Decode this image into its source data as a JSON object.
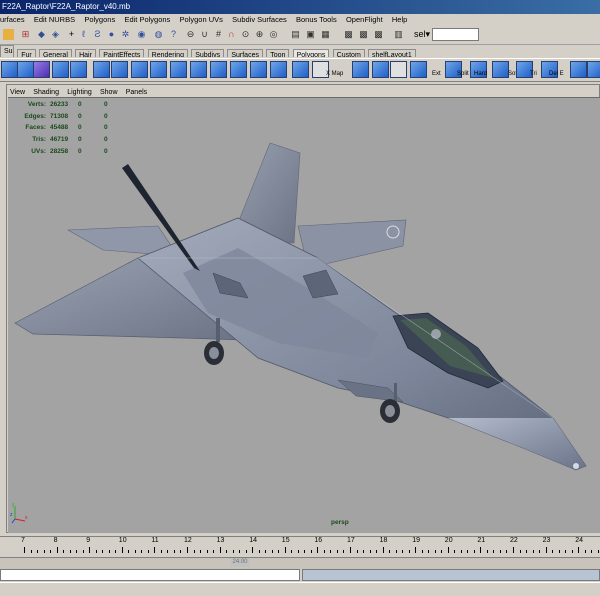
{
  "window": {
    "title": "F22A_Raptor\\F22A_Raptor_v40.mb"
  },
  "menu": [
    "urfaces",
    "Edit NURBS",
    "Polygons",
    "Edit Polygons",
    "Polygon UVs",
    "Subdiv Surfaces",
    "Bonus Tools",
    "OpenFlight",
    "Help"
  ],
  "status_line": {
    "selection_field_label": "sel▾",
    "selection_field_value": ""
  },
  "shelf_tabs": [
    "Subdivs",
    "Fur",
    "General",
    "Hair",
    "PaintEffects",
    "Rendering",
    "Subdivs",
    "Surfaces",
    "Toon",
    "Polygons",
    "Custom",
    "shelfLayout1"
  ],
  "active_shelf_tab": "Polygons",
  "shelf_labels": [
    "X Map",
    "Ext",
    "Split",
    "Hard",
    "Soft",
    "Tri",
    "Del E"
  ],
  "panel_menu": [
    "View",
    "Shading",
    "Lighting",
    "Show",
    "Panels"
  ],
  "hud": [
    {
      "label": "Verts:",
      "v1": "26233",
      "v2": "0",
      "v3": "0"
    },
    {
      "label": "Edges:",
      "v1": "71308",
      "v2": "0",
      "v3": "0"
    },
    {
      "label": "Faces:",
      "v1": "45488",
      "v2": "0",
      "v3": "0"
    },
    {
      "label": "Tris:",
      "v1": "46719",
      "v2": "0",
      "v3": "0"
    },
    {
      "label": "UVs:",
      "v1": "28258",
      "v2": "0",
      "v3": "0"
    }
  ],
  "camera": "persp",
  "axis": {
    "x": "x",
    "y": "y",
    "z": "z"
  },
  "timeline": {
    "ticks": [
      "7",
      "8",
      "9",
      "10",
      "11",
      "12",
      "13",
      "14",
      "15",
      "16",
      "17",
      "18",
      "19",
      "20",
      "21",
      "22",
      "23",
      "24"
    ]
  },
  "range": {
    "field": "24.00"
  },
  "colors": {
    "viewport_bg": "#a3a3a3",
    "hud_text": "#1a4a1a",
    "title_bar": "#0a246a",
    "aircraft_body": "#8a93a6"
  }
}
